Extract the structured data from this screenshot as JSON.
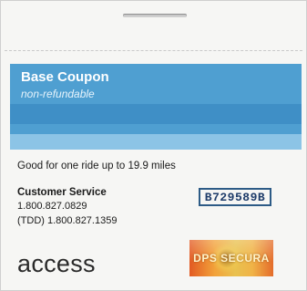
{
  "banner": {
    "title": "Base Coupon",
    "subtitle": "non-refundable",
    "color": "#4f9fd1"
  },
  "ride_limit": "Good for one ride up to 19.9 miles",
  "customer_service": {
    "label": "Customer Service",
    "phone": "1.800.827.0829",
    "tdd": "(TDD) 1.800.827.1359"
  },
  "serial_number": "B729589B",
  "logo": "access",
  "hologram": {
    "text": "DPS SECURA"
  }
}
